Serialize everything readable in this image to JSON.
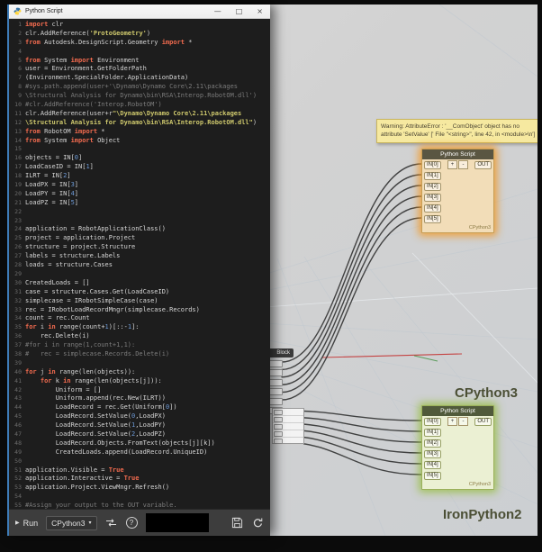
{
  "window": {
    "title": "Python Script",
    "minimize": "—",
    "maximize": "□",
    "close": "×"
  },
  "icons": {
    "run": "▶",
    "caret": "▾",
    "help": "?"
  },
  "editor": {
    "code_lines": [
      "import clr",
      "clr.AddReference('ProtoGeometry')",
      "from Autodesk.DesignScript.Geometry import *",
      "",
      "from System import Environment",
      "user = Environment.GetFolderPath",
      "(Environment.SpecialFolder.ApplicationData)",
      "#sys.path.append(user+'\\Dynamo\\Dynamo Core\\2.11\\packages",
      "\\Structural Analysis for Dynamo\\bin\\RSA\\Interop.RobotOM.dll')",
      "#clr.AddReference('Interop.RobotOM')",
      "clr.AddReference(user+r\"\\Dynamo\\Dynamo Core\\2.11\\packages",
      "\\Structural Analysis for Dynamo\\bin\\RSA\\Interop.RobotOM.dll\")",
      "from RobotOM import *",
      "from System import Object",
      "",
      "objects = IN[0]",
      "LoadCaseID = IN[1]",
      "ILRT = IN[2]",
      "LoadPX = IN[3]",
      "LoadPY = IN[4]",
      "LoadPZ = IN[5]",
      "",
      "",
      "application = RobotApplicationClass()",
      "project = application.Project",
      "structure = project.Structure",
      "labels = structure.Labels",
      "loads = structure.Cases",
      "",
      "CreatedLoads = []",
      "case = structure.Cases.Get(LoadCaseID)",
      "simplecase = IRobotSimpleCase(case)",
      "rec = IRobotLoadRecordMngr(simplecase.Records)",
      "count = rec.Count",
      "for i in range(count+1)[::-1]:",
      "    rec.Delete(i)",
      "#for i in range(1,count+1,1):",
      "#   rec = simplecase.Records.Delete(i)",
      "",
      "for j in range(len(objects)):",
      "    for k in range(len(objects[j])):",
      "        Uniform = []",
      "        Uniform.append(rec.New(ILRT))",
      "        LoadRecord = rec.Get(Uniform[0])",
      "        LoadRecord.SetValue(0,LoadPX)",
      "        LoadRecord.SetValue(1,LoadPY)",
      "        LoadRecord.SetValue(2,LoadPZ)",
      "        LoadRecord.Objects.FromText(objects[j][k])",
      "        CreatedLoads.append(LoadRecord.UniqueID)",
      "",
      "application.Visible = True",
      "application.Interactive = True",
      "application.Project.ViewMngr.Refresh()",
      "",
      "#Assign your output to the OUT variable."
    ]
  },
  "toolbar": {
    "run_label": "Run",
    "engine": "CPython3"
  },
  "canvas": {
    "warning_tooltip": "Warning: AttributeError : '__ComObject' object has no attribute 'SetValue' [' File \"<string>\", line 42, in <module>\\n']",
    "partial_block_title": "Block",
    "labels": [
      "CPython3",
      "IronPython2"
    ],
    "wires": {
      "to_warning_node": 6,
      "to_selected_node": 6
    },
    "nodes": [
      {
        "id": "node-warning",
        "title": "Python Script",
        "state": "warning",
        "inputs": [
          "IN[0]",
          "IN[1]",
          "IN[2]",
          "IN[3]",
          "IN[4]",
          "IN[5]"
        ],
        "output": "OUT",
        "add_button": "+",
        "remove_button": "-",
        "engine_badge": "CPython3"
      },
      {
        "id": "node-selected",
        "title": "Python Script",
        "state": "selected",
        "inputs": [
          "IN[0]",
          "IN[1]",
          "IN[2]",
          "IN[3]",
          "IN[4]",
          "IN[5]"
        ],
        "output": "OUT",
        "add_button": "+",
        "remove_button": "-",
        "engine_badge": "CPython3"
      }
    ]
  }
}
